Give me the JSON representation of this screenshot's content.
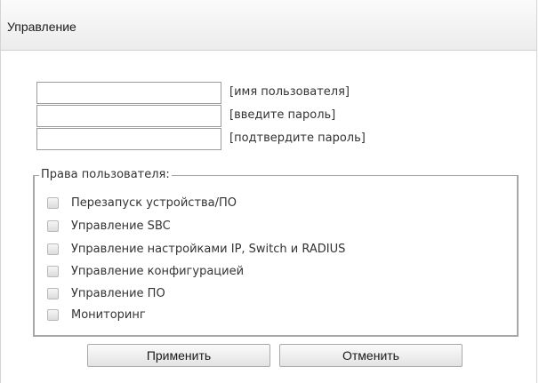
{
  "dialog": {
    "title": "Управление"
  },
  "fields": [
    {
      "value": "",
      "label": "[имя пользователя]"
    },
    {
      "value": "",
      "label": "[введите пароль]"
    },
    {
      "value": "",
      "label": "[подтвердите пароль]"
    }
  ],
  "rights": {
    "legend": "Права пользователя:",
    "items": [
      {
        "label": "Перезапуск устройства/ПО",
        "checked": false
      },
      {
        "label": "Управление SBC",
        "checked": false
      },
      {
        "label": "Управление настройками IP, Switch и RADIUS",
        "checked": false
      },
      {
        "label": "Управление конфигурацией",
        "checked": false
      },
      {
        "label": "Управление ПО",
        "checked": false
      },
      {
        "label": "Мониторинг",
        "checked": false
      }
    ]
  },
  "buttons": {
    "apply": "Применить",
    "cancel": "Отменить"
  }
}
